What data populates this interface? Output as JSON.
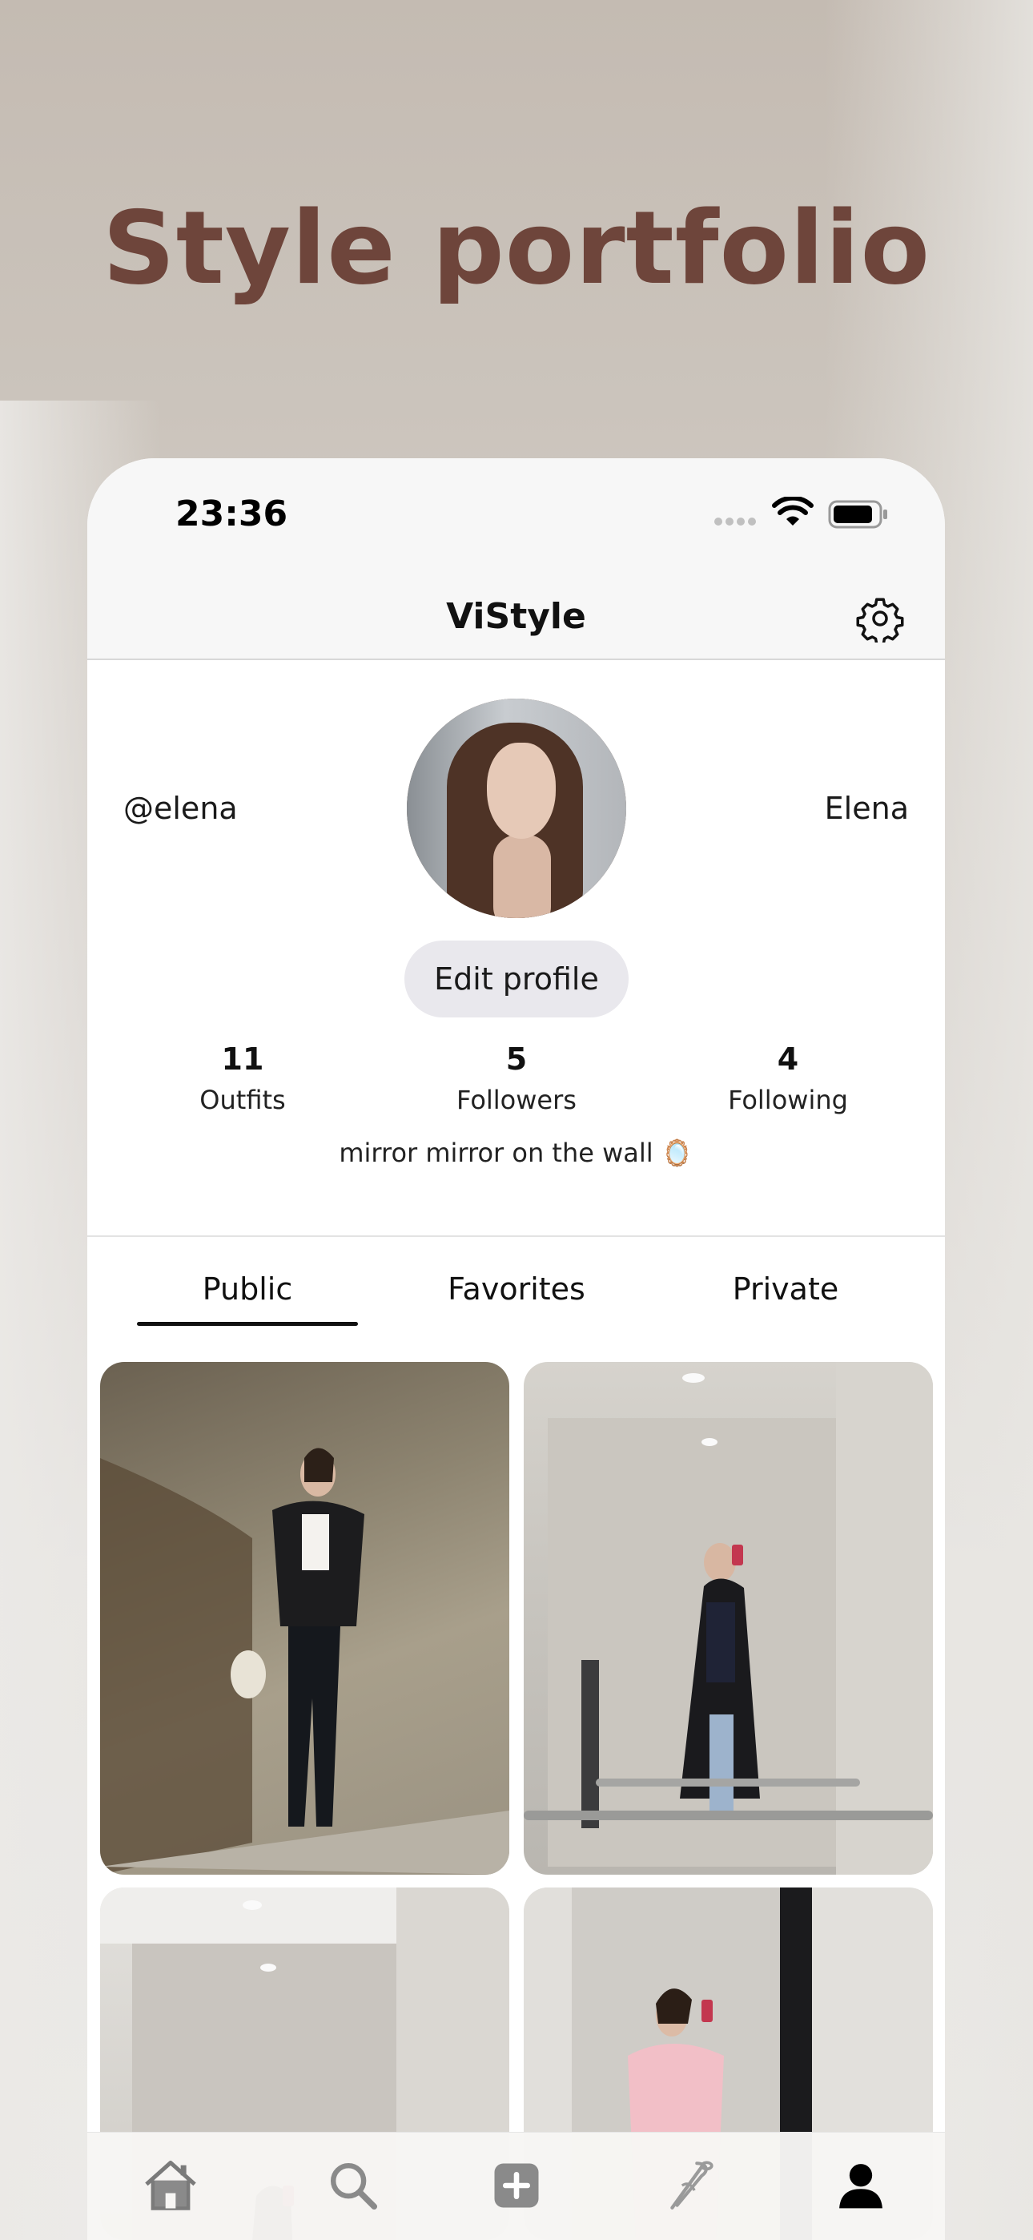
{
  "headline": "Style portfolio",
  "status_bar": {
    "time": "23:36"
  },
  "nav": {
    "title": "ViStyle",
    "settings_icon": "gear-icon"
  },
  "profile": {
    "handle": "@elena",
    "display_name": "Elena",
    "edit_button": "Edit profile",
    "stats": [
      {
        "value": "11",
        "label": "Outfits"
      },
      {
        "value": "5",
        "label": "Followers"
      },
      {
        "value": "4",
        "label": "Following"
      }
    ],
    "bio": "mirror mirror on the wall 🪞"
  },
  "tabs": [
    {
      "label": "Public",
      "active": true
    },
    {
      "label": "Favorites",
      "active": false
    },
    {
      "label": "Private",
      "active": false
    }
  ],
  "tab_bar": {
    "icons": [
      "home-icon",
      "search-icon",
      "add-icon",
      "hanger-icon",
      "profile-icon"
    ]
  },
  "colors": {
    "headline": "#6e453b",
    "active_tab_underline": "#111111",
    "edit_button_bg": "#e9e8ed"
  }
}
